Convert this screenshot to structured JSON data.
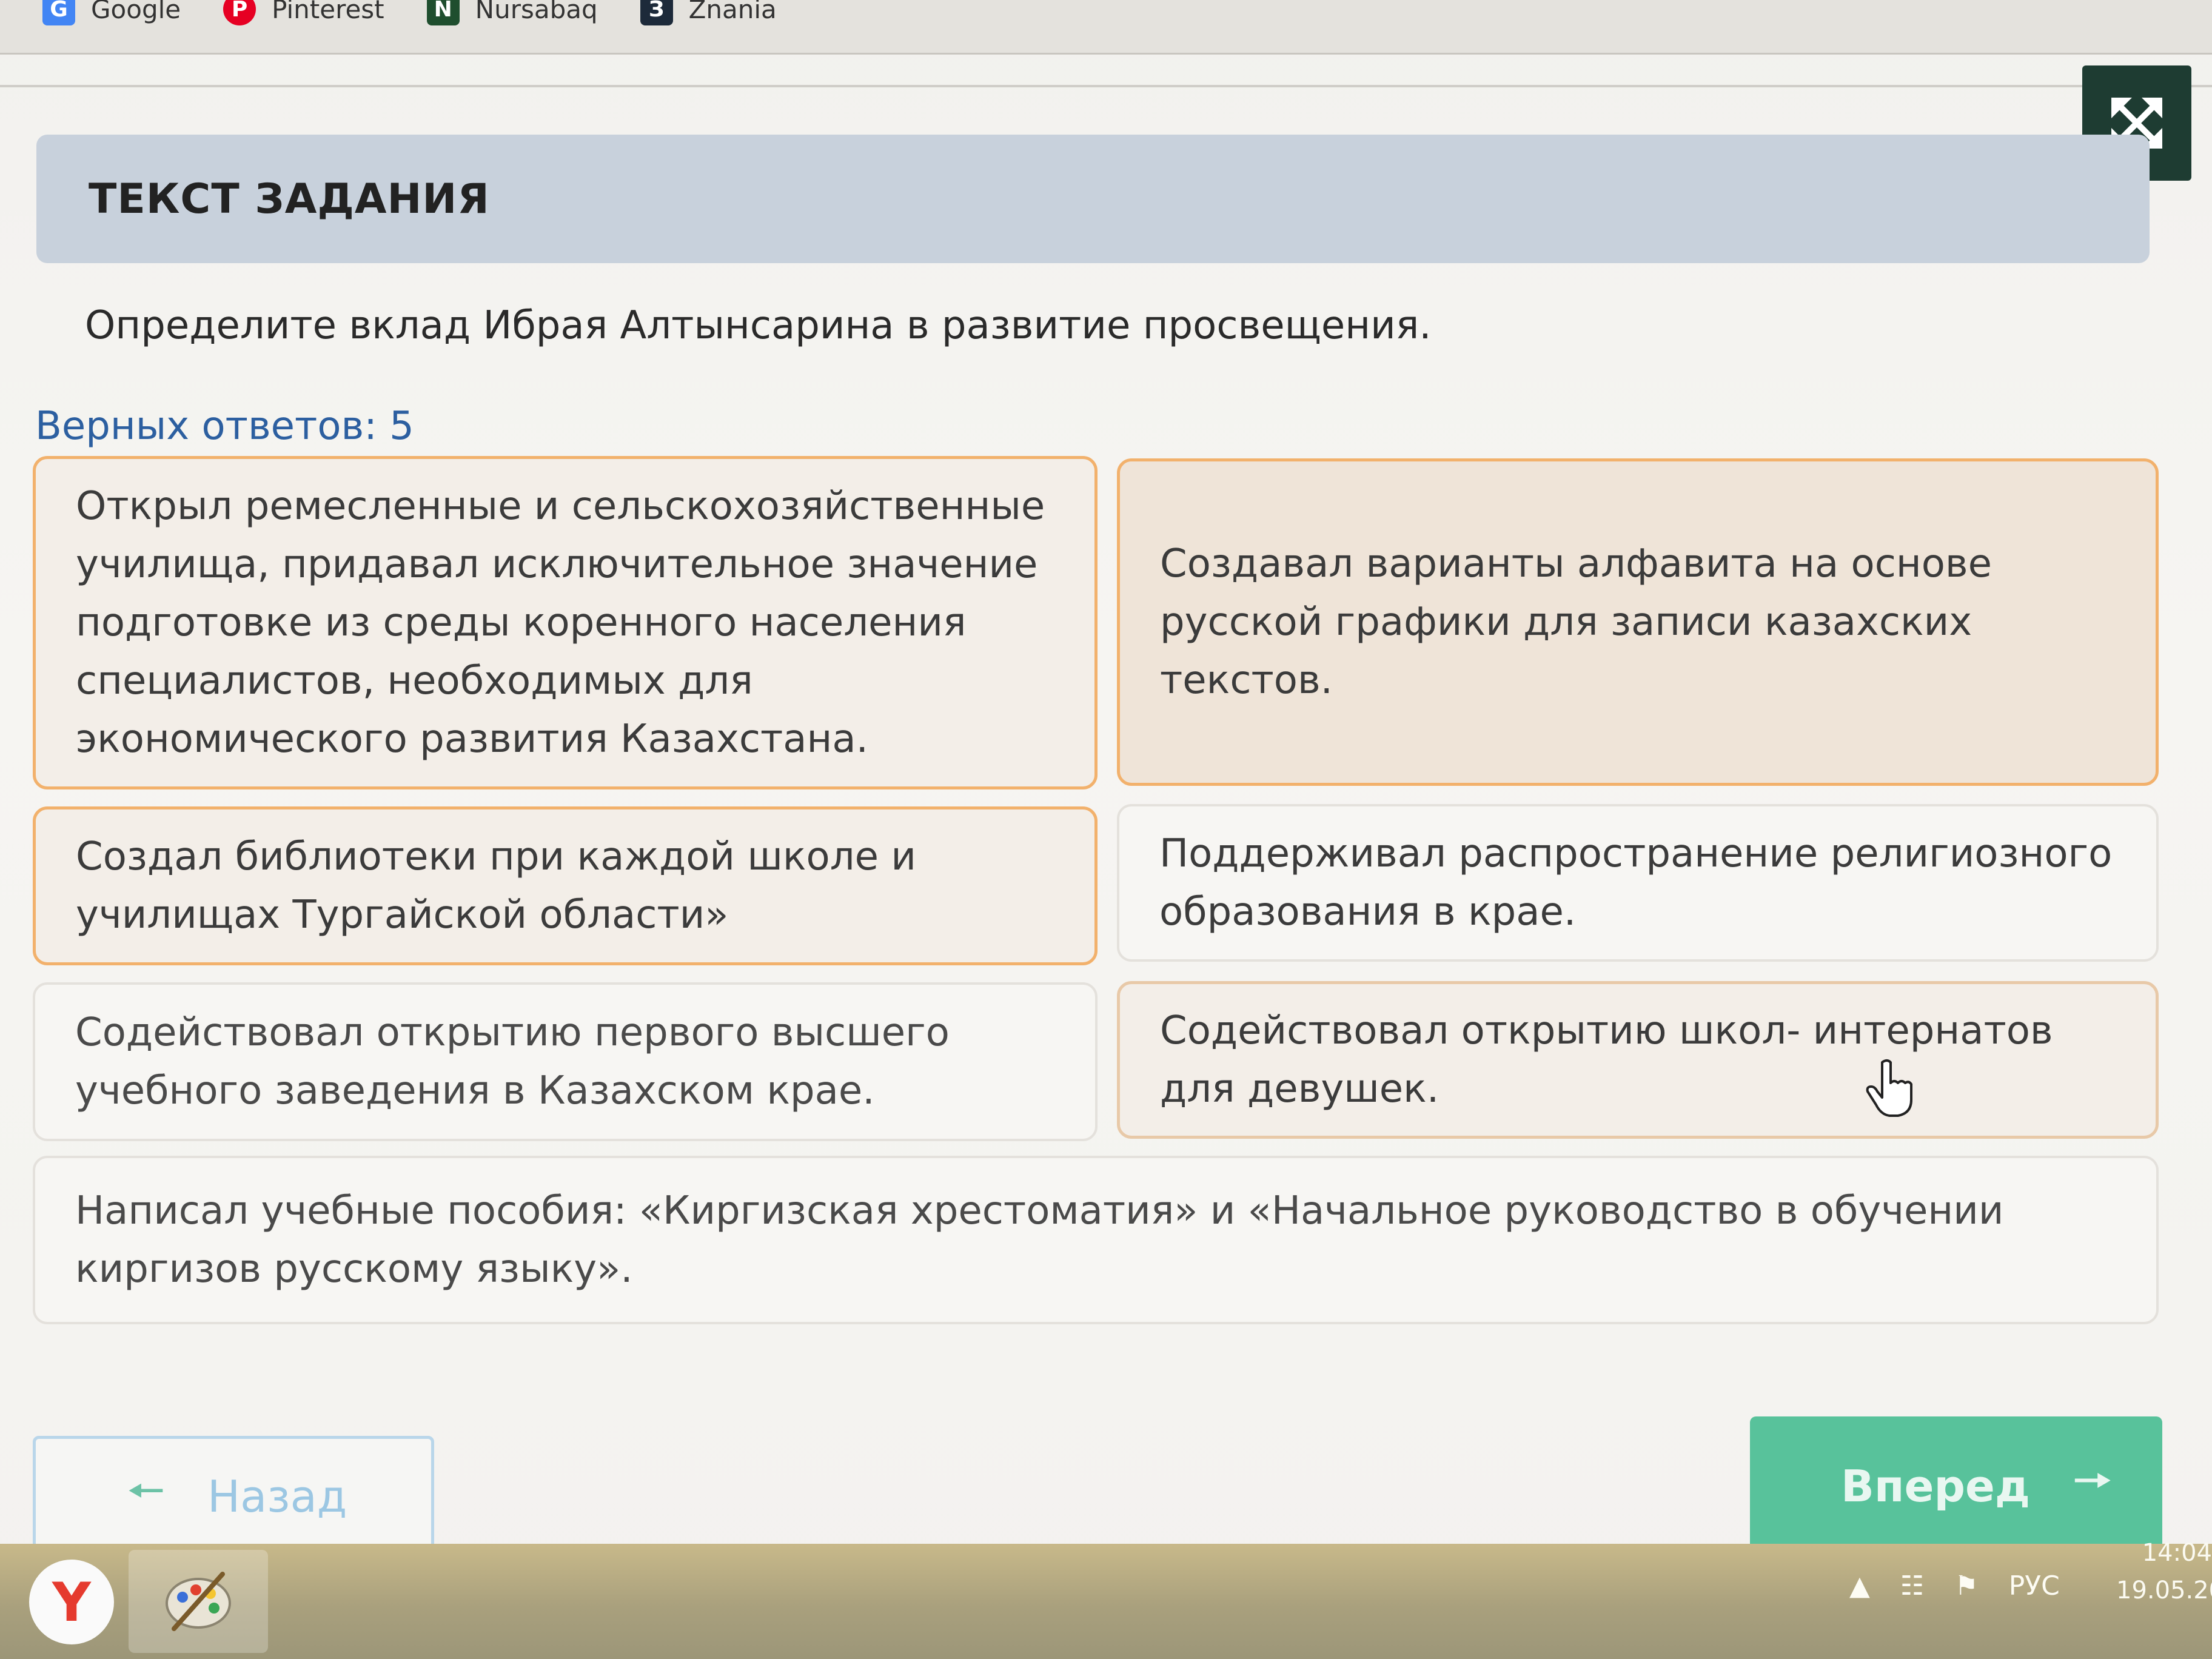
{
  "bookmarks": [
    {
      "label": "Google",
      "icon": "google-icon",
      "color": "#4285f4",
      "glyph": "G"
    },
    {
      "label": "Pinterest",
      "icon": "pinterest-icon",
      "color": "#e60023",
      "glyph": "P"
    },
    {
      "label": "Nursabaq",
      "icon": "nursabaq-icon",
      "color": "#1f4e2e",
      "glyph": "N"
    },
    {
      "label": "Znania",
      "icon": "znania-icon",
      "color": "#1d2a3a",
      "glyph": "З"
    }
  ],
  "task": {
    "header": "ТЕКСТ ЗАДАНИЯ",
    "question": "Определите вклад Ибрая Алтынсарина в развитие просвещения.",
    "answers_count": "Верных ответов: 5"
  },
  "answers": [
    {
      "id": "c1",
      "text": "Открыл ремесленные и сельскохозяйственные училища, придавал исключительное значение подготовке из среды коренного населения специалистов, необходимых для экономического развития Казахстана."
    },
    {
      "id": "c2",
      "text": "Создавал варианты алфавита на основе русской графики для записи казахских текстов."
    },
    {
      "id": "c3",
      "text": "Создал библиотеки при каждой школе и училищах Тургайской области»"
    },
    {
      "id": "c4",
      "text": "Поддерживал распространение религиозного образования в крае."
    },
    {
      "id": "c5",
      "text": "Содействовал открытию первого высшего учебного заведения в Казахском крае."
    },
    {
      "id": "c6",
      "text": "Содействовал открытию школ- интернатов для девушек."
    },
    {
      "id": "c7",
      "text": "Написал учебные пособия: «Киргизская хрестоматия» и «Начальное руководство в обучении киргизов русскому языку»."
    }
  ],
  "nav": {
    "back_label": "Назад",
    "next_label": "Вперед"
  },
  "taskbar": {
    "start_glyph": "Y",
    "language": "РУС",
    "time": "14:04",
    "date": "19.05.20"
  }
}
